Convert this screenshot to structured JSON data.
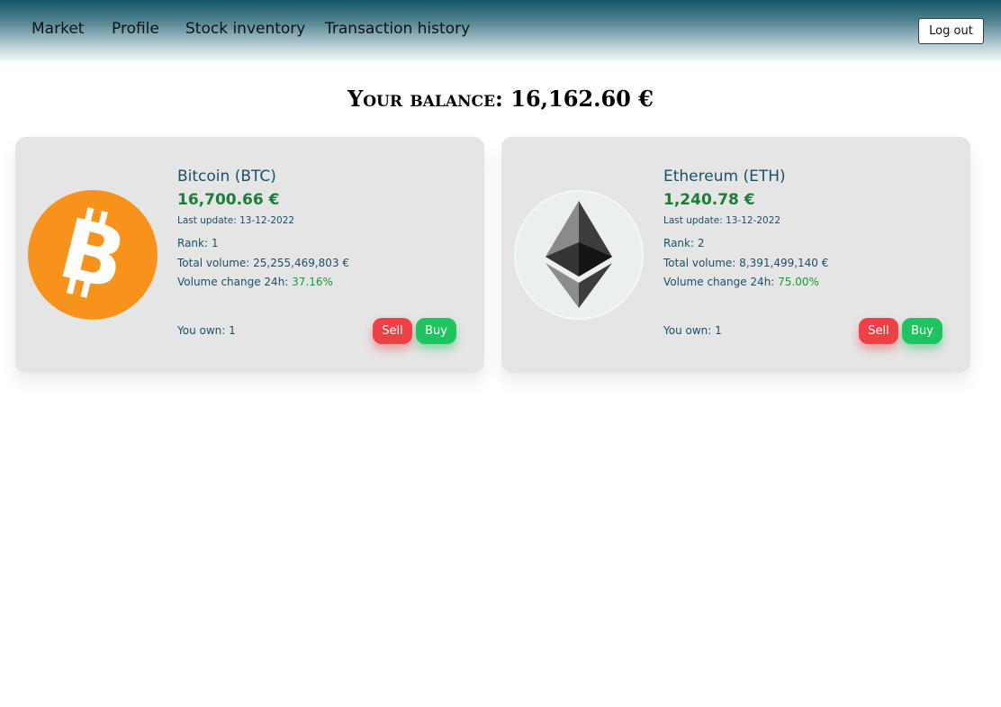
{
  "nav": {
    "items": [
      {
        "label": "Market"
      },
      {
        "label": "Profile"
      },
      {
        "label": "Stock inventory"
      },
      {
        "label": "Transaction history"
      }
    ],
    "logout_label": "Log out"
  },
  "balance": {
    "label": "Your balance:",
    "amount": "16,162.60 €"
  },
  "cards": [
    {
      "name": "Bitcoin (BTC)",
      "price": "16,700.66 €",
      "last_update": "Last update: 13-12-2022",
      "rank": "Rank: 1",
      "total_volume": "Total volume: 25,255,469,803 €",
      "volume_change_label": "Volume change 24h:",
      "volume_change_value": "37.16%",
      "owned": "You own: 1",
      "sell_label": "Sell",
      "buy_label": "Buy",
      "icon": "bitcoin-logo",
      "color": "#f7931a"
    },
    {
      "name": "Ethereum (ETH)",
      "price": "1,240.78 €",
      "last_update": "Last update: 13-12-2022",
      "rank": "Rank: 2",
      "total_volume": "Total volume: 8,391,499,140 €",
      "volume_change_label": "Volume change 24h:",
      "volume_change_value": "75.00%",
      "owned": "You own: 1",
      "sell_label": "Sell",
      "buy_label": "Buy",
      "icon": "ethereum-logo",
      "color": "#ecefef"
    }
  ],
  "colors": {
    "nav_dark": "#145466",
    "card_bg": "#e5e5e5",
    "text_blue": "#19506a",
    "price_green": "#1b7d3b",
    "sell_red": "#ef4046",
    "buy_green": "#1fc35f"
  }
}
